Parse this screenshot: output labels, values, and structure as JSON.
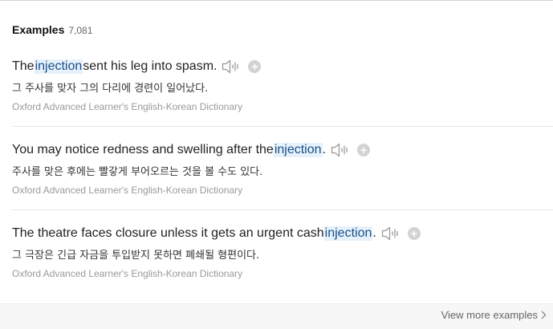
{
  "header": {
    "title": "Examples",
    "count": "7,081"
  },
  "examples": [
    {
      "before": "The ",
      "highlight": "injection",
      "after": " sent his leg into spasm.",
      "translation": "그 주사를 맞자 그의 다리에 경련이 일어났다.",
      "source": "Oxford Advanced Learner's English-Korean Dictionary"
    },
    {
      "before": "You may notice redness and swelling after the ",
      "highlight": "injection",
      "after": ".",
      "translation": "주사를 맞은 후에는 빨갛게 부어오르는 것을 볼 수도 있다.",
      "source": "Oxford Advanced Learner's English-Korean Dictionary"
    },
    {
      "before": "The theatre faces closure unless it gets an urgent cash ",
      "highlight": "injection",
      "after": ".",
      "translation": "그 극장은 긴급 자금을 투입받지 못하면 폐쇄될 형편이다.",
      "source": "Oxford Advanced Learner's English-Korean Dictionary"
    }
  ],
  "footer": {
    "view_more_label": "View more examples"
  },
  "icons": {
    "speaker": "speaker-icon",
    "add": "plus-circle-icon",
    "chevron": "chevron-right-icon"
  },
  "colors": {
    "highlight_bg": "#e6f1fb",
    "highlight_text": "#1a4f8a",
    "source_text": "#999999",
    "icon_gray": "#9a9a9a",
    "plus_bg": "#d3d3d3"
  }
}
